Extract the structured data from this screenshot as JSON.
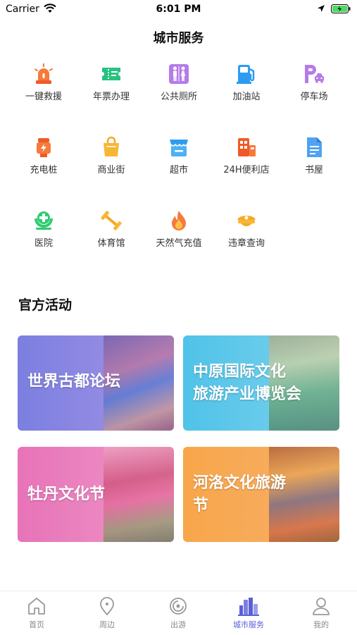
{
  "status_bar": {
    "carrier": "Carrier",
    "time": "6:01 PM"
  },
  "page": {
    "title": "城市服务"
  },
  "services": [
    {
      "label": "一键救援",
      "icon": "siren-icon"
    },
    {
      "label": "年票办理",
      "icon": "ticket-icon"
    },
    {
      "label": "公共厕所",
      "icon": "restroom-icon"
    },
    {
      "label": "加油站",
      "icon": "gas-station-icon"
    },
    {
      "label": "停车场",
      "icon": "parking-icon"
    },
    {
      "label": "充电桩",
      "icon": "charging-pile-icon"
    },
    {
      "label": "商业街",
      "icon": "shopping-bag-icon"
    },
    {
      "label": "超市",
      "icon": "supermarket-icon"
    },
    {
      "label": "24H便利店",
      "icon": "convenience-store-icon"
    },
    {
      "label": "书屋",
      "icon": "book-icon"
    },
    {
      "label": "医院",
      "icon": "hospital-icon"
    },
    {
      "label": "体育馆",
      "icon": "dumbbell-icon"
    },
    {
      "label": "天然气充值",
      "icon": "flame-icon"
    },
    {
      "label": "违章查询",
      "icon": "police-cap-icon"
    }
  ],
  "activities": {
    "title": "官方活动",
    "cards": [
      {
        "lines": [
          "世界古都论坛"
        ],
        "color_from": "#7b7fe0",
        "color_to": "#c9a3e6"
      },
      {
        "lines": [
          "中原国际文化",
          "旅游产业博览会"
        ],
        "color_from": "#4fc3e8",
        "color_to": "#8fd8ee"
      },
      {
        "lines": [
          "牡丹文化节"
        ],
        "color_from": "#e773b8",
        "color_to": "#f2a6cf"
      },
      {
        "lines": [
          "河洛文化旅游",
          "节"
        ],
        "color_from": "#f8a64a",
        "color_to": "#f5b878"
      }
    ]
  },
  "tabbar": {
    "tabs": [
      {
        "label": "首页",
        "icon": "home-icon"
      },
      {
        "label": "周边",
        "icon": "location-pin-icon"
      },
      {
        "label": "出游",
        "icon": "travel-icon"
      },
      {
        "label": "城市服务",
        "icon": "city-buildings-icon"
      },
      {
        "label": "我的",
        "icon": "person-icon"
      }
    ],
    "active_index": 3
  },
  "colors": {
    "accent": "#5a5fd8"
  }
}
